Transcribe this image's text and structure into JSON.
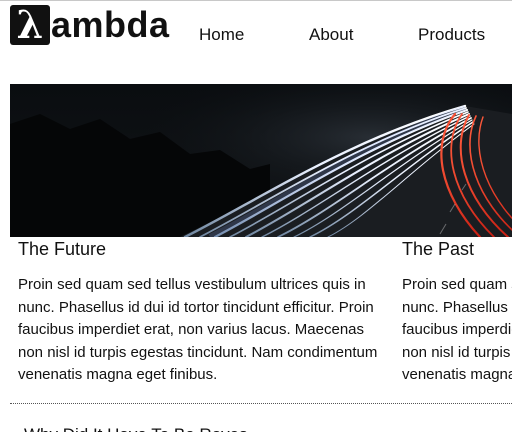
{
  "header": {
    "logo_glyph": "λ",
    "logo_text": "ambda",
    "nav": [
      "Home",
      "About",
      "Products"
    ]
  },
  "hero": {
    "image_icon": "highway-light-trails-image"
  },
  "cards": [
    {
      "title": "The Future",
      "body": "Proin sed quam sed tellus vestibulum ultrices quis in nunc. Phasellus id dui id tortor tincidunt efficitur. Proin faucibus imperdiet erat, non varius lacus. Maecenas non nisl id turpis egestas tincidunt. Nam condimentum venenatis magna eget finibus."
    },
    {
      "title": "The Past",
      "body": "Proin sed quam sed tellus vestibulum ultrices quis in nunc. Phasellus id dui id tortor tincidunt efficitur. Proin faucibus imperdiet erat, non varius lacus. Maecenas non nisl id turpis egestas tincidunt. Nam condimentum venenatis magna eget finibus."
    }
  ],
  "section": {
    "title": "Why Did It Have To Be Roves"
  }
}
